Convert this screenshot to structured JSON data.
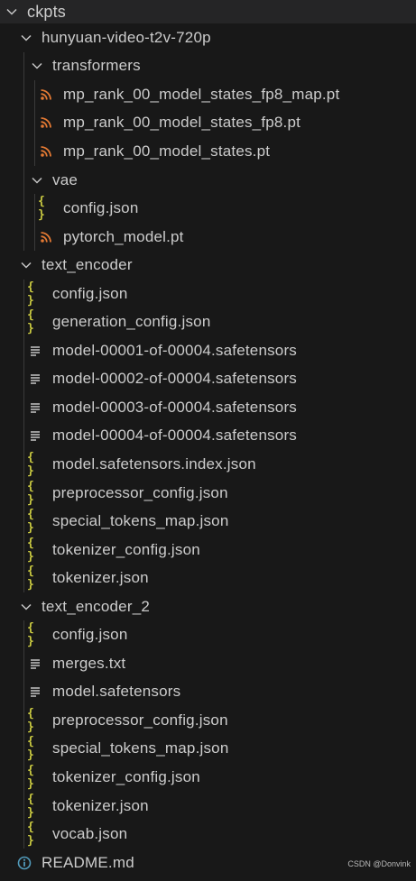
{
  "explorer": {
    "root_label": "ckpts",
    "folder_hunyuan": "hunyuan-video-t2v-720p",
    "folder_transformers": "transformers",
    "files_transformers": [
      "mp_rank_00_model_states_fp8_map.pt",
      "mp_rank_00_model_states_fp8.pt",
      "mp_rank_00_model_states.pt"
    ],
    "folder_vae": "vae",
    "files_vae": [
      "config.json",
      "pytorch_model.pt"
    ],
    "folder_text_encoder": "text_encoder",
    "files_text_encoder": [
      "config.json",
      "generation_config.json",
      "model-00001-of-00004.safetensors",
      "model-00002-of-00004.safetensors",
      "model-00003-of-00004.safetensors",
      "model-00004-of-00004.safetensors",
      "model.safetensors.index.json",
      "preprocessor_config.json",
      "special_tokens_map.json",
      "tokenizer_config.json",
      "tokenizer.json"
    ],
    "folder_text_encoder_2": "text_encoder_2",
    "files_text_encoder_2": [
      "config.json",
      "merges.txt",
      "model.safetensors",
      "preprocessor_config.json",
      "special_tokens_map.json",
      "tokenizer_config.json",
      "tokenizer.json",
      "vocab.json"
    ],
    "readme": "README.md",
    "watermark": "CSDN @Donvink"
  },
  "colors": {
    "background": "#181818",
    "header_background": "#252526",
    "text": "#cccccc",
    "json_icon": "#cbcb41",
    "rss_icon": "#e37933",
    "text_file_icon": "#c5c5c5",
    "info_icon": "#519aba",
    "chevron": "#c5c5c5"
  },
  "icons": {
    "expanded": "chevron-down-icon",
    "pt_file": "rss-icon",
    "json_file": "braces-icon",
    "text_file": "lines-icon",
    "markdown_file": "info-icon"
  }
}
